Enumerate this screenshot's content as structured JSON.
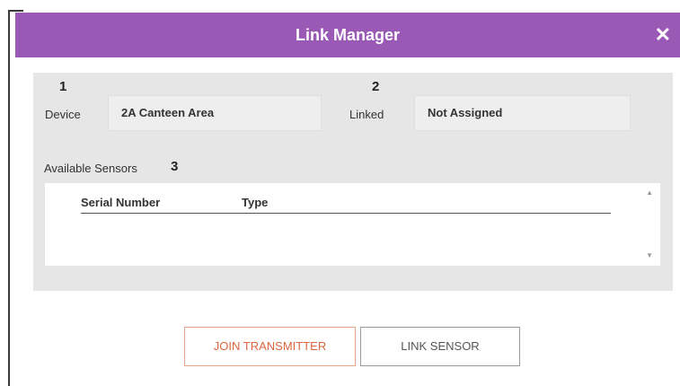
{
  "dialog": {
    "title": "Link Manager",
    "close_symbol": "✕"
  },
  "device": {
    "marker": "1",
    "label": "Device",
    "value": "2A Canteen Area"
  },
  "linked": {
    "marker": "2",
    "label": "Linked",
    "value": "Not Assigned"
  },
  "sensors": {
    "label": "Available Sensors",
    "marker": "3",
    "columns": [
      "Serial Number",
      "Type"
    ],
    "rows": []
  },
  "buttons": {
    "join_transmitter": "JOIN TRANSMITTER",
    "link_sensor": "LINK SENSOR"
  },
  "colors": {
    "title_bar": "#9b59b6",
    "join_accent": "#d9663d"
  }
}
